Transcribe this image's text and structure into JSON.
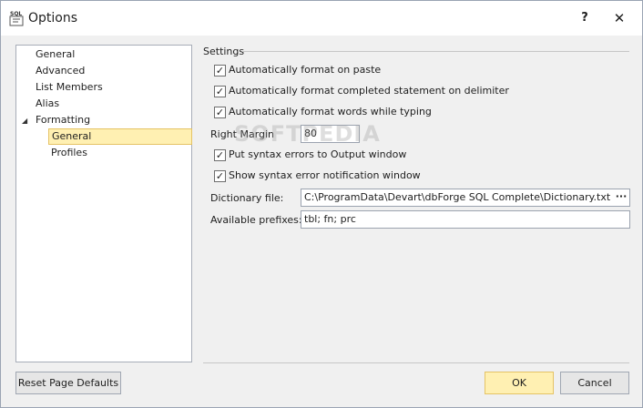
{
  "window": {
    "title": "Options",
    "help_glyph": "?",
    "close_glyph": "✕"
  },
  "tree": {
    "items": [
      {
        "label": "General"
      },
      {
        "label": "Advanced"
      },
      {
        "label": "List Members"
      },
      {
        "label": "Alias"
      },
      {
        "label": "Formatting",
        "expanded": true
      },
      {
        "label": "General",
        "selected": true
      },
      {
        "label": "Profiles"
      }
    ]
  },
  "settings": {
    "group_title": "Settings",
    "checkboxes": [
      {
        "label": "Automatically format on paste",
        "checked": true
      },
      {
        "label": "Automatically format completed statement on delimiter",
        "checked": true
      },
      {
        "label": "Automatically format words while typing",
        "checked": true
      },
      {
        "label": "Put syntax errors to Output window",
        "checked": true
      },
      {
        "label": "Show syntax error notification window",
        "checked": true
      }
    ],
    "right_margin": {
      "label": "Right Margin",
      "value": "80"
    },
    "dictionary_file": {
      "label": "Dictionary file:",
      "value": "C:\\ProgramData\\Devart\\dbForge SQL Complete\\Dictionary.txt",
      "browse_glyph": "···"
    },
    "available_prefixes": {
      "label": "Available prefixes:",
      "value": "tbl; fn; prc"
    }
  },
  "watermark": "SOFTPEDIA",
  "buttons": {
    "reset": "Reset Page Defaults",
    "ok": "OK",
    "cancel": "Cancel"
  },
  "icons": {
    "app": "sql-app-icon",
    "check": "✓",
    "expand": "◢"
  },
  "colors": {
    "selection_bg": "#fff0b2",
    "selection_border": "#e5c365"
  }
}
